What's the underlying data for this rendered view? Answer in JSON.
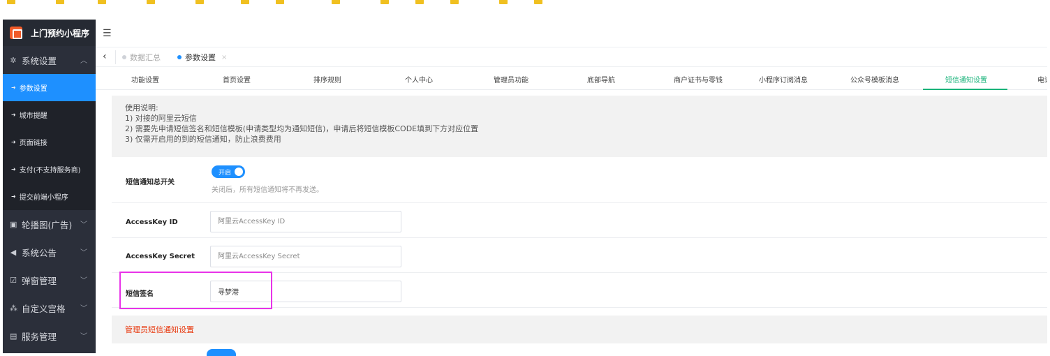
{
  "colors": {
    "accent": "#1e90ff",
    "subnav_active": "#19b37a",
    "sidebar_bg": "#2b2f3a",
    "warning_text": "#e8380d",
    "highlight": "#e833e8"
  },
  "brand": {
    "name": "上门预约小程序",
    "icon": "app-logo-icon"
  },
  "sidebar": {
    "groups": [
      {
        "label": "系统设置",
        "icon": "gear-icon",
        "expanded": true
      },
      {
        "label": "轮播图(广告)",
        "icon": "image-icon",
        "expanded": false
      },
      {
        "label": "系统公告",
        "icon": "speaker-icon",
        "expanded": false
      },
      {
        "label": "弹窗管理",
        "icon": "checkbox-icon",
        "expanded": false
      },
      {
        "label": "自定义宫格",
        "icon": "grid-tree-icon",
        "expanded": false
      },
      {
        "label": "服务管理",
        "icon": "list-card-icon",
        "expanded": false
      }
    ],
    "sub_items": [
      {
        "label": "参数设置",
        "active": true
      },
      {
        "label": "城市提醒",
        "active": false
      },
      {
        "label": "页面链接",
        "active": false
      },
      {
        "label": "支付(不支持服务商)",
        "active": false
      },
      {
        "label": "提交前端小程序",
        "active": false
      }
    ]
  },
  "tabs": [
    {
      "label": "数据汇总",
      "active": false
    },
    {
      "label": "参数设置",
      "active": true,
      "closable": true
    }
  ],
  "subnav": [
    "功能设置",
    "首页设置",
    "排序规则",
    "个人中心",
    "管理员功能",
    "底部导航",
    "商户证书与零钱",
    "小程序订阅消息",
    "公众号模板消息",
    "短信通知设置",
    "电话"
  ],
  "subnav_active": "短信通知设置",
  "notice": {
    "lines": [
      "使用说明:",
      "1) 对接的阿里云短信",
      "2) 需要先申请短信签名和短信模板(申请类型均为通知短信)，申请后将短信模板CODE填到下方对应位置",
      "3) 仅需开启用的到的短信通知，防止浪费费用"
    ]
  },
  "form": {
    "sms_switch": {
      "label": "短信通知总开关",
      "state_text": "开启",
      "on": true,
      "hint": "关闭后，所有短信通知将不再发送。"
    },
    "access_key_id": {
      "label": "AccessKey ID",
      "value": "",
      "placeholder": "阿里云AccessKey ID"
    },
    "access_key_secret": {
      "label": "AccessKey Secret",
      "value": "",
      "placeholder": "阿里云AccessKey Secret"
    },
    "sms_sign": {
      "label": "短信签名",
      "value": "寻梦港",
      "placeholder": ""
    }
  },
  "section": {
    "admin_sms_title": "管理员短信通知设置"
  }
}
